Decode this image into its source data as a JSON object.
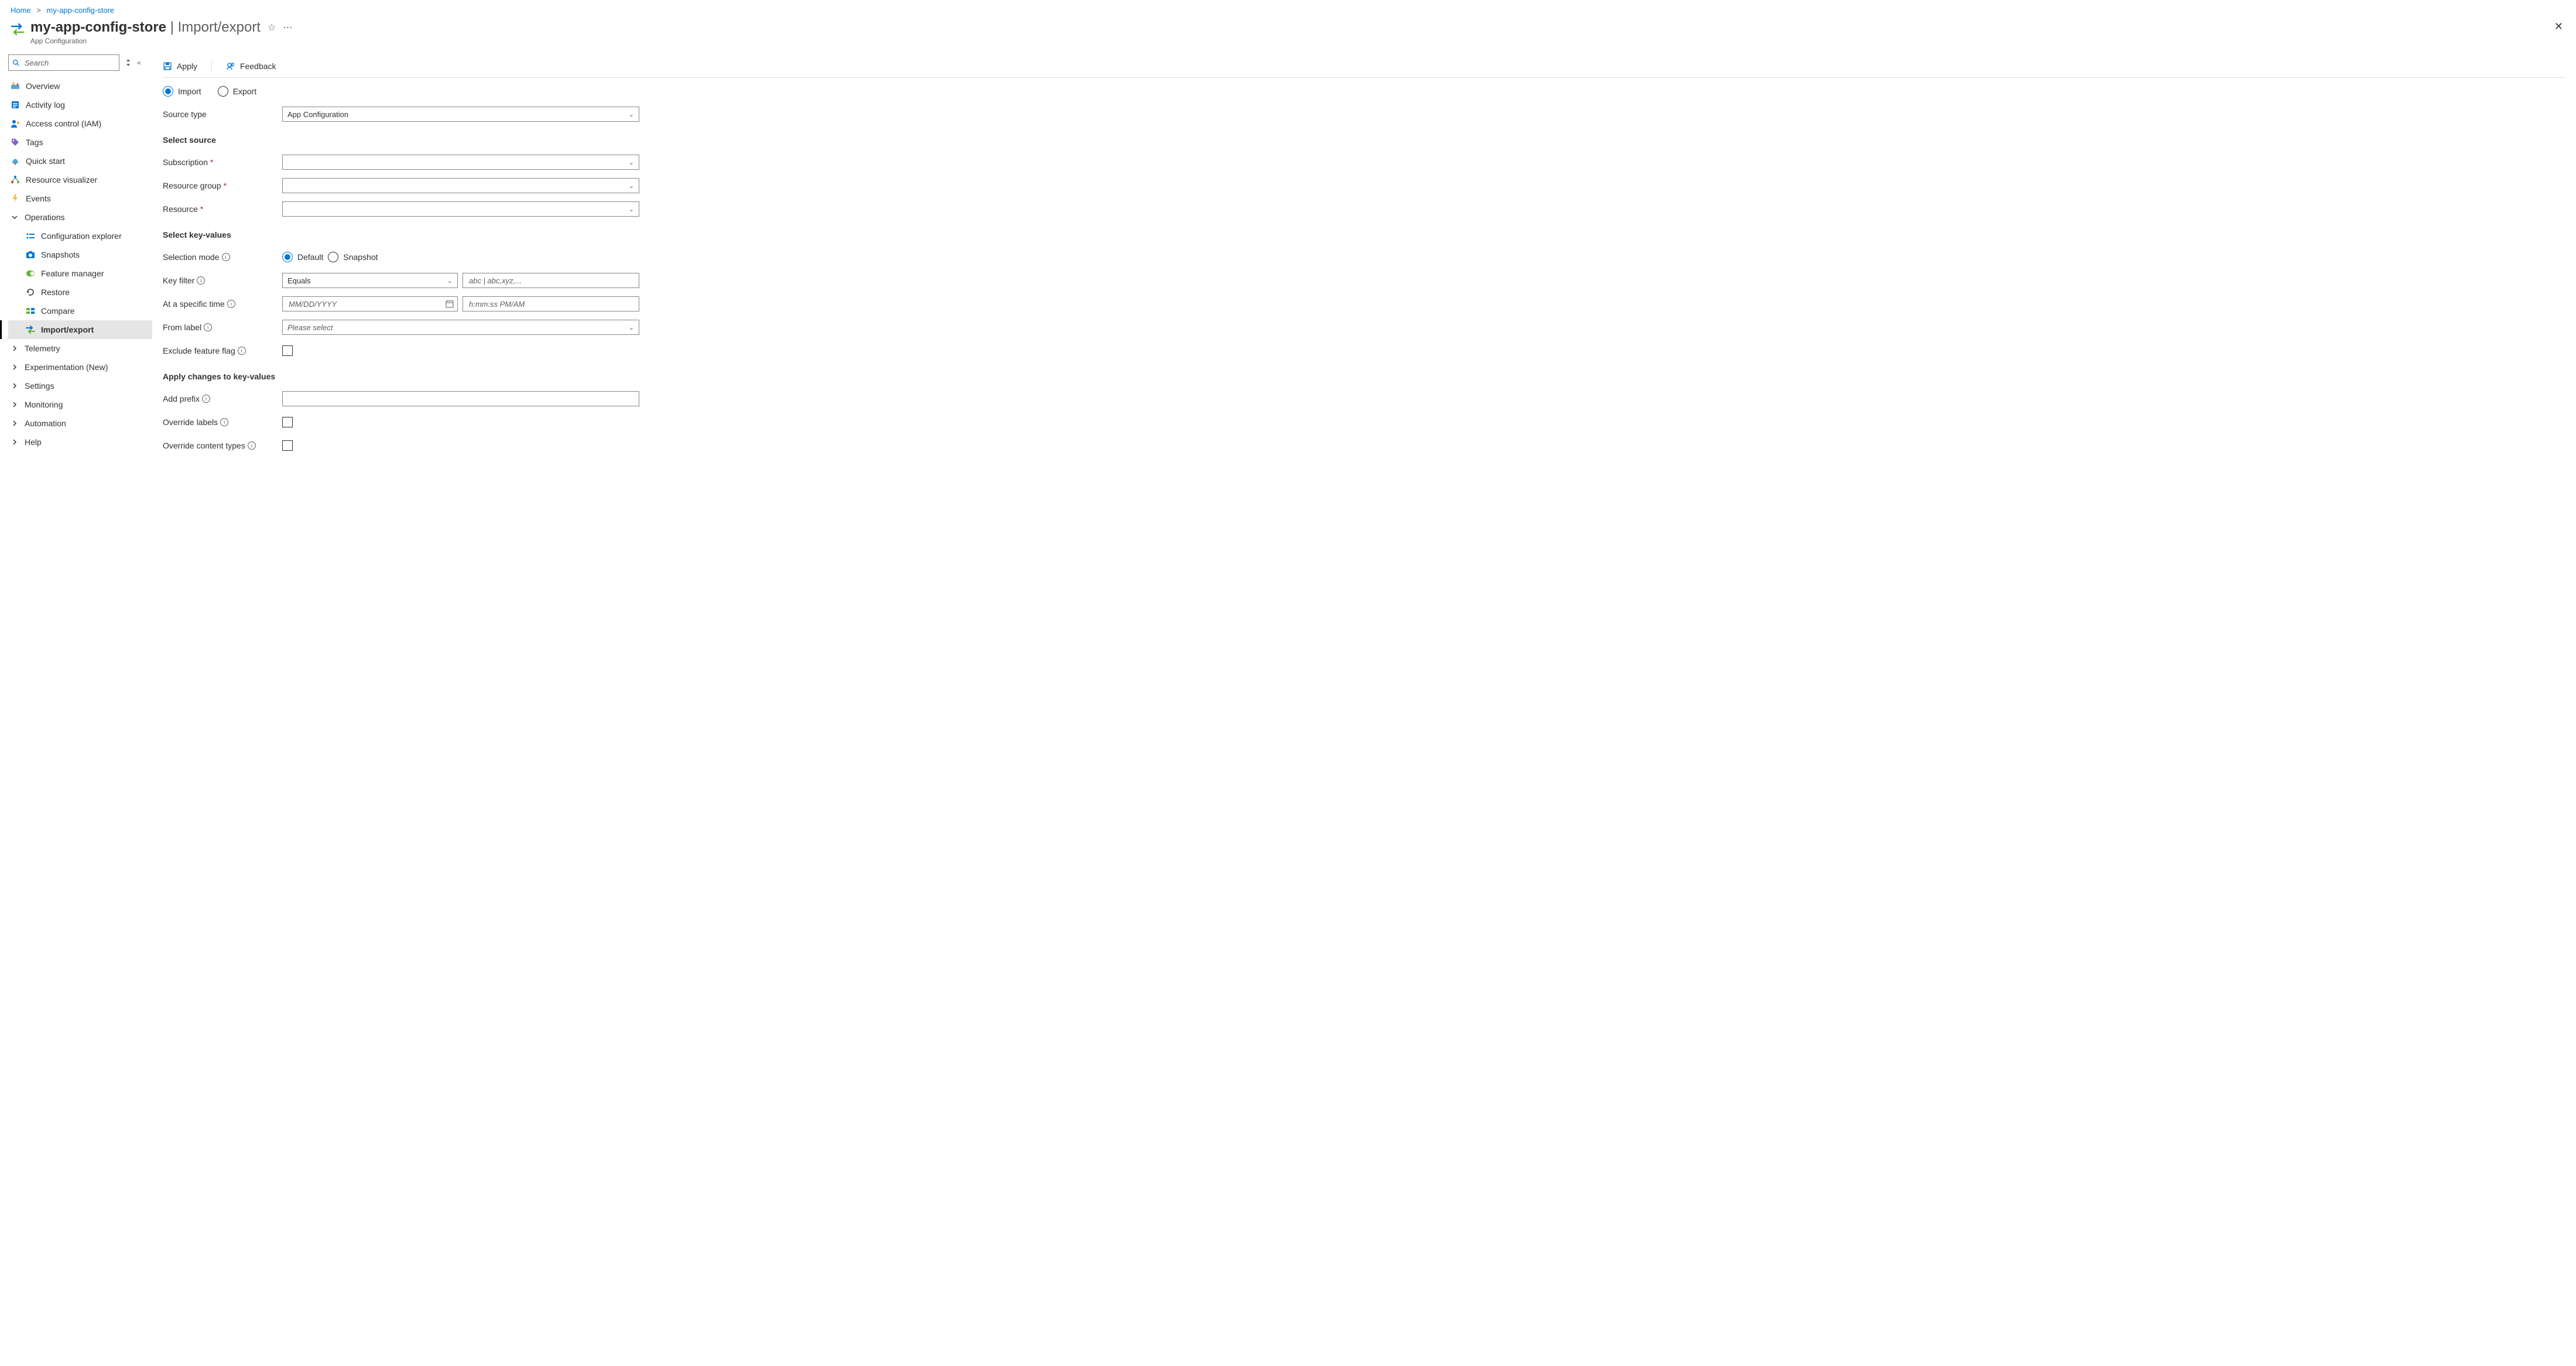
{
  "breadcrumb": {
    "home": "Home",
    "resource": "my-app-config-store"
  },
  "header": {
    "title": "my-app-config-store",
    "section": "Import/export",
    "subtitle": "App Configuration"
  },
  "sidebar": {
    "search_placeholder": "Search",
    "items": {
      "overview": "Overview",
      "activity": "Activity log",
      "access": "Access control (IAM)",
      "tags": "Tags",
      "quickstart": "Quick start",
      "resourceviz": "Resource visualizer",
      "events": "Events",
      "operations": "Operations",
      "configexplorer": "Configuration explorer",
      "snapshots": "Snapshots",
      "featuremgr": "Feature manager",
      "restore": "Restore",
      "compare": "Compare",
      "importexport": "Import/export",
      "telemetry": "Telemetry",
      "experimentation": "Experimentation (New)",
      "settings": "Settings",
      "monitoring": "Monitoring",
      "automation": "Automation",
      "help": "Help"
    }
  },
  "toolbar": {
    "apply": "Apply",
    "feedback": "Feedback"
  },
  "form": {
    "radio_import": "Import",
    "radio_export": "Export",
    "source_type_label": "Source type",
    "source_type_value": "App Configuration",
    "select_source_title": "Select source",
    "subscription_label": "Subscription",
    "resource_group_label": "Resource group",
    "resource_label": "Resource",
    "select_kv_title": "Select key-values",
    "selection_mode_label": "Selection mode",
    "radio_default": "Default",
    "radio_snapshot": "Snapshot",
    "key_filter_label": "Key filter",
    "key_filter_op": "Equals",
    "key_filter_placeholder": "abc | abc,xyz,...",
    "specific_time_label": "At a specific time",
    "date_placeholder": "MM/DD/YYYY",
    "time_placeholder": "h:mm:ss PM/AM",
    "from_label_label": "From label",
    "from_label_placeholder": "Please select",
    "exclude_ff_label": "Exclude feature flag",
    "apply_changes_title": "Apply changes to key-values",
    "add_prefix_label": "Add prefix",
    "override_labels_label": "Override labels",
    "override_ct_label": "Override content types"
  }
}
